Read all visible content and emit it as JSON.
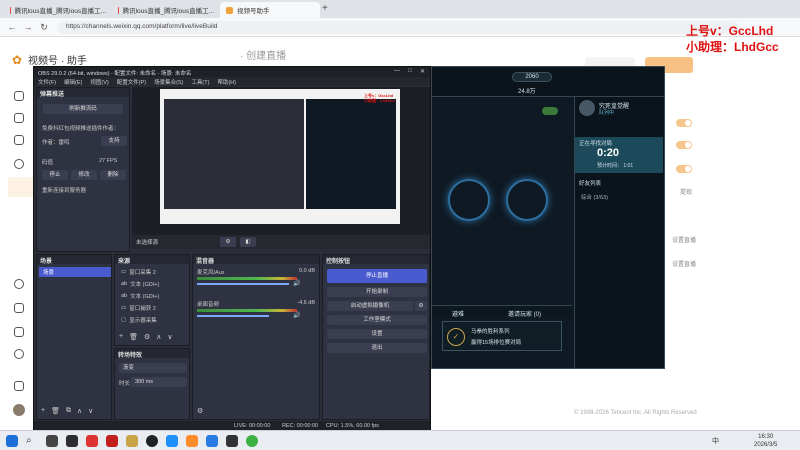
{
  "browser": {
    "tabs": [
      {
        "label": "腾讯lous直播_腾讯lous直播工..."
      },
      {
        "label": "腾讯lous直播_腾讯lous直播工..."
      },
      {
        "label": "视频号助手"
      }
    ],
    "url": "https://channels.weixin.qq.com/platform/live/liveBuild"
  },
  "overlay": {
    "line1": "上号v：GccLhd",
    "line2": "小助理：LhdGcc"
  },
  "page": {
    "logo_title": "视频号 · 助手",
    "header_hint": "· 创建直播",
    "right_labels": [
      "提现",
      "设置直播",
      "设置直播"
    ],
    "copyright": "© 1998-2026 Tencent Inc. All Rights Reserved"
  },
  "obs": {
    "title": "OBS 29.0.2 (64-bit, windows) - 配置文件: 未命名 - 场景: 未命名",
    "menu": [
      "文件(F)",
      "编辑(E)",
      "视图(V)",
      "配置文件(P)",
      "场景集合(S)",
      "工具(T)",
      "帮助(H)"
    ],
    "plugin": {
      "header": "弹幕推送",
      "refresh_btn": "刷新推流码",
      "desc": "免费抖红包视频推送插件作者：",
      "author_label": "作者：雷鸣",
      "support_btn": "支持",
      "bitrate_label": "码值",
      "fps": "27 FPS",
      "stop_btn": "停止",
      "modify_btn": "修改",
      "delete_btn": "删除",
      "reconnect": "重新连接到服务器"
    },
    "preview_label": "未选择源",
    "scenes": {
      "header": "场景",
      "items": [
        "场景"
      ]
    },
    "sources": {
      "header": "来源",
      "items": [
        "窗口采集 2",
        "文本 (GDI+)",
        "文本 (GDI+)",
        "窗口捕获 2",
        "显示器采集"
      ]
    },
    "transitions": {
      "header": "转场特效",
      "type": "渐变",
      "duration_label": "时长",
      "duration": "300 ms"
    },
    "mixer": {
      "header": "混音器",
      "channels": [
        {
          "name": "麦克风/Aux",
          "db": "0.0 dB"
        },
        {
          "name": "桌面音频",
          "db": "-4.6 dB"
        }
      ]
    },
    "controls": {
      "header": "控制按钮",
      "stop_stream": "停止直播",
      "start_record": "开始录制",
      "virtual_cam": "启动虚拟摄像机",
      "studio_mode": "工作室模式",
      "settings": "设置",
      "exit": "退出"
    },
    "status": {
      "live": "LIVE: 00:00:00",
      "rec": "REC: 00:00:00",
      "cpu": "CPU: 1.5%, 60.00 fps"
    }
  },
  "game": {
    "currency1": "2060",
    "currency2": "24.8万",
    "in_match_title": "正在寻找对局",
    "timer": "0:20",
    "estimated": "预计时间： 1:01",
    "friends_header": "好友列表",
    "friend_group": "综合 (3/63)",
    "profile_name": "究死皇觉醒",
    "profile_status": "队列中",
    "tab_left": "避难",
    "tab_mid": "邀请玩家 (0)",
    "task_title": "马拳的胜利系列",
    "task_desc": "赢得15场排位赛对局"
  },
  "taskbar": {
    "time": "16:30",
    "date": "2026/3/5",
    "ime": "中"
  }
}
